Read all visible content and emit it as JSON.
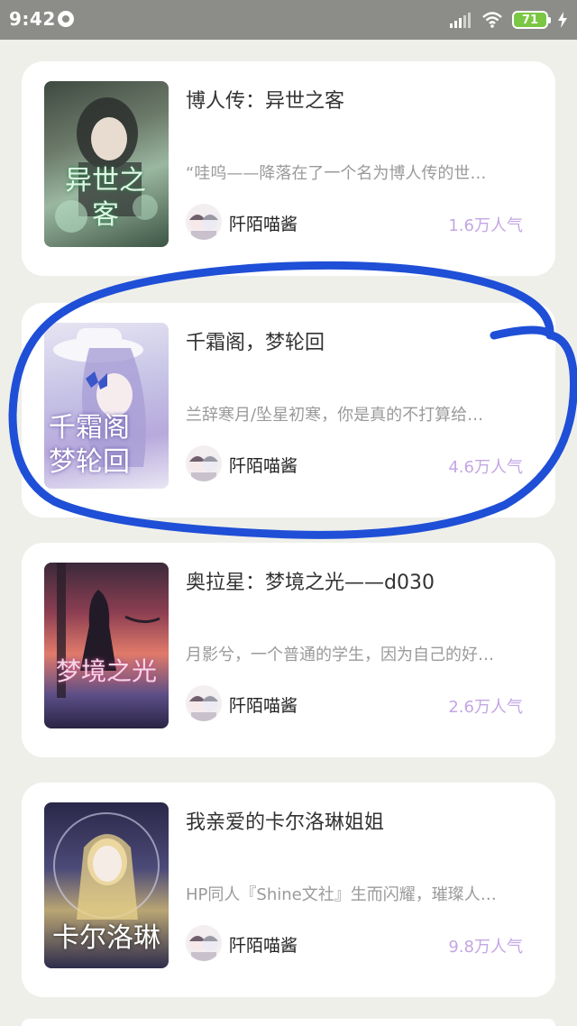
{
  "status_bar": {
    "time": "9:42",
    "battery": "71"
  },
  "books": [
    {
      "title": "博人传：异世之客",
      "description": "“哇呜——降落在了一个名为博人传的世…",
      "author": "阡陌喵酱",
      "popularity": "1.6万人气",
      "cover_text": "异世之客"
    },
    {
      "title": "千霜阁，梦轮回",
      "description": "兰辞寒月/坠星初寒，你是真的不打算给…",
      "author": "阡陌喵酱",
      "popularity": "4.6万人气",
      "cover_text": "千霜阁梦轮回"
    },
    {
      "title": "奥拉星：梦境之光——d030",
      "description": "月影兮，一个普通的学生，因为自己的好…",
      "author": "阡陌喵酱",
      "popularity": "2.6万人气",
      "cover_text": "梦境之光"
    },
    {
      "title": "我亲爱的卡尔洛琳姐姐",
      "description": "HP同人『Shine文社』生而闪耀，璀璨人…",
      "author": "阡陌喵酱",
      "popularity": "9.8万人气",
      "cover_text": "卡尔洛琳"
    }
  ],
  "colors": {
    "accent": "#c3a6e4",
    "annotation": "#1f4fd6",
    "status_bar": "#8c8c88",
    "battery": "#7bc744"
  }
}
